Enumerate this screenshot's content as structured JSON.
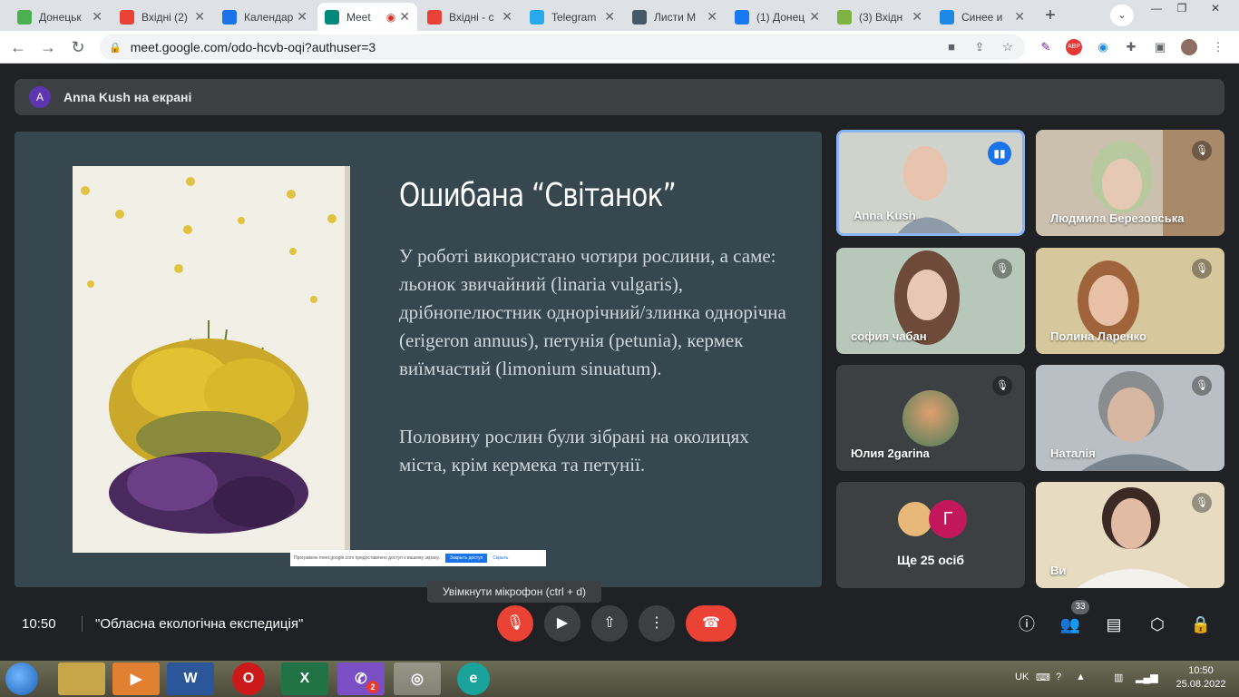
{
  "browser": {
    "tabs": [
      {
        "title": "Донецьк",
        "icon": "donetsk-site-icon",
        "color": "#4caf50"
      },
      {
        "title": "Вхідні (2)",
        "icon": "gmail-icon",
        "color": "#ea4335"
      },
      {
        "title": "Календар",
        "icon": "calendar-icon",
        "color": "#1a73e8"
      },
      {
        "title": "Meet",
        "icon": "meet-icon",
        "color": "#00897b",
        "active": true
      },
      {
        "title": "Вхідні - с",
        "icon": "gmail-icon",
        "color": "#ea4335"
      },
      {
        "title": "Telegram",
        "icon": "telegram-icon",
        "color": "#29a9eb"
      },
      {
        "title": "Листи M",
        "icon": "mail-icon",
        "color": "#455a64"
      },
      {
        "title": "(1) Донец",
        "icon": "facebook-icon",
        "color": "#1877f2"
      },
      {
        "title": "(3) Вхідн",
        "icon": "mail-icon",
        "color": "#7cb342"
      },
      {
        "title": "Синее и",
        "icon": "site-icon",
        "color": "#1e88e5"
      }
    ],
    "url": "meet.google.com/odo-hcvb-oqi?authuser=3"
  },
  "meet": {
    "presenter_avatar": "A",
    "presenter_text": "Anna Kush на екрані",
    "slide": {
      "title": "Ошибана “Світанок”",
      "paragraph1": "У роботі використано чотири рослини, а саме: льонок звичайний (linaria vulgaris), дрібнопелюстник однорічний/злинка однорічна (erigeron annuus), петунія (petunia), кермек виїмчастий (limonium sinuatum).",
      "paragraph2": "Половину рослин були зібрані на околицях міста, крім кермека та петунії.",
      "share_notice": "Програмою meet.google.com предоставлено доступ к вашему экрану.",
      "share_stop": "Закрыть доступ",
      "share_hide": "Скрыть"
    },
    "participants": [
      {
        "name": "Anna Kush",
        "speaking": true
      },
      {
        "name": "Людмила Березовська"
      },
      {
        "name": "софия чабан"
      },
      {
        "name": "Полина Ларенко"
      },
      {
        "name": "Юлия 2garina"
      },
      {
        "name": "Наталія"
      },
      {
        "name": "Ще 25 осіб",
        "avatar_letter": "Г"
      },
      {
        "name": "Ви"
      }
    ],
    "tooltip": "Увімкнути мікрофон (ctrl + d)",
    "time": "10:50",
    "meeting_name": "\"Обласна екологічна експедиція\"",
    "participant_count": "33"
  },
  "taskbar": {
    "apps": [
      "explorer",
      "media",
      "W",
      "O",
      "X",
      "viber",
      "chrome",
      "e"
    ],
    "viber_badge": "2",
    "lang": "UK",
    "time": "10:50",
    "date": "25.08.2022"
  }
}
